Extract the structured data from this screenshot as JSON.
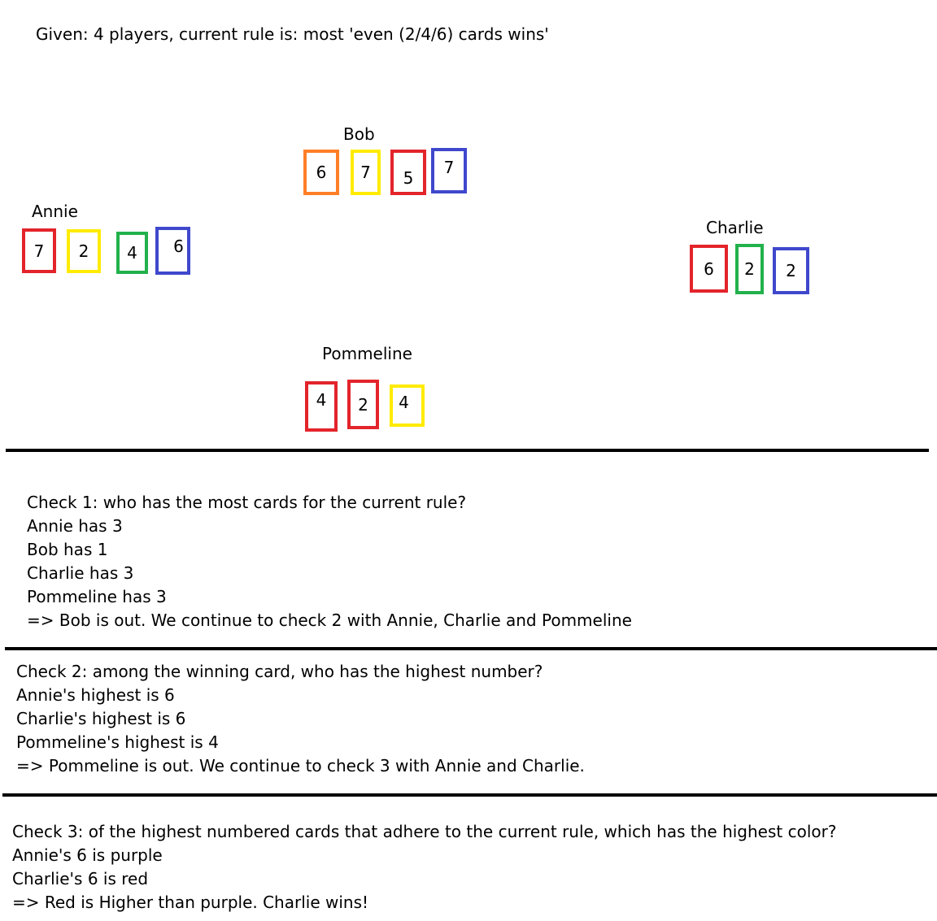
{
  "given": "Given: 4 players, current rule is: most 'even (2/4/6) cards wins'",
  "colors": {
    "red": "#e3242b",
    "yellow": "#ffeb00",
    "green": "#22b14c",
    "blue": "#3f48cc",
    "orange": "#ff7f27"
  },
  "players": [
    {
      "name": "Bob",
      "cards": [
        {
          "value": "6",
          "color": "orange"
        },
        {
          "value": "7",
          "color": "yellow"
        },
        {
          "value": "5",
          "color": "red"
        },
        {
          "value": "7",
          "color": "blue"
        }
      ]
    },
    {
      "name": "Annie",
      "cards": [
        {
          "value": "7",
          "color": "red"
        },
        {
          "value": "2",
          "color": "yellow"
        },
        {
          "value": "4",
          "color": "green"
        },
        {
          "value": "6",
          "color": "blue"
        }
      ]
    },
    {
      "name": "Charlie",
      "cards": [
        {
          "value": "6",
          "color": "red"
        },
        {
          "value": "2",
          "color": "green"
        },
        {
          "value": "2",
          "color": "blue"
        }
      ]
    },
    {
      "name": "Pommeline",
      "cards": [
        {
          "value": "4",
          "color": "red"
        },
        {
          "value": "2",
          "color": "red"
        },
        {
          "value": "4",
          "color": "yellow"
        }
      ]
    }
  ],
  "checks": [
    {
      "lines": [
        "Check 1: who has the most cards for the current rule?",
        "Annie has 3",
        "Bob has 1",
        "Charlie has 3",
        "Pommeline has 3",
        "=> Bob is out. We continue to check 2 with Annie, Charlie and Pommeline"
      ]
    },
    {
      "lines": [
        "Check 2: among the winning card, who has the highest number?",
        "Annie's highest is 6",
        "Charlie's highest is 6",
        "Pommeline's highest is 4",
        "=> Pommeline is out. We continue to check 3 with Annie and Charlie."
      ]
    },
    {
      "lines": [
        "Check 3: of the highest numbered cards that adhere to the current rule, which has the highest color?",
        "Annie's 6 is purple",
        "Charlie's 6 is red",
        "=> Red is Higher than purple. Charlie wins!"
      ]
    }
  ]
}
